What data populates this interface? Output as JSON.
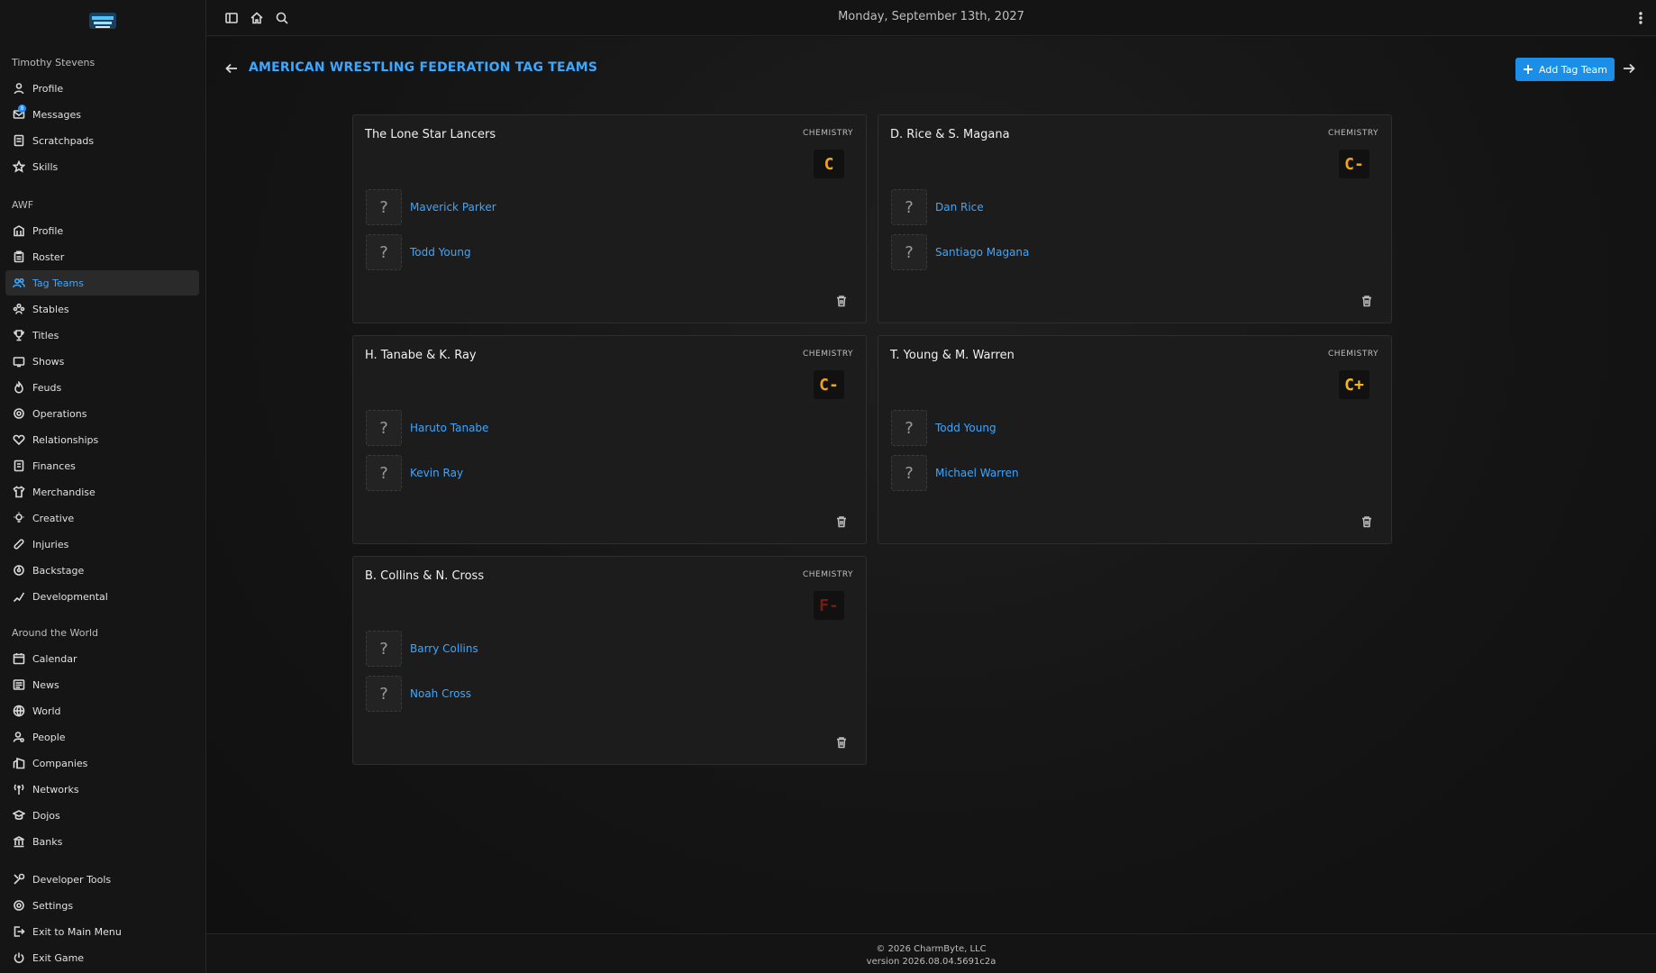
{
  "sidebar": {
    "user_name": "Timothy Stevens",
    "personal": [
      {
        "label": "Profile",
        "icon": "user-icon"
      },
      {
        "label": "Messages",
        "icon": "mail-icon",
        "badge": "8"
      },
      {
        "label": "Scratchpads",
        "icon": "notepad-icon"
      },
      {
        "label": "Skills",
        "icon": "star-icon"
      }
    ],
    "company_title": "AWF",
    "company": [
      {
        "label": "Profile",
        "icon": "building-icon"
      },
      {
        "label": "Roster",
        "icon": "clipboard-icon"
      },
      {
        "label": "Tag Teams",
        "icon": "users-icon"
      },
      {
        "label": "Stables",
        "icon": "group-icon"
      },
      {
        "label": "Titles",
        "icon": "trophy-icon"
      },
      {
        "label": "Shows",
        "icon": "tv-icon"
      },
      {
        "label": "Feuds",
        "icon": "flame-icon"
      },
      {
        "label": "Operations",
        "icon": "gear-icon"
      },
      {
        "label": "Relationships",
        "icon": "heart-icon"
      },
      {
        "label": "Finances",
        "icon": "finance-icon"
      },
      {
        "label": "Merchandise",
        "icon": "shirt-icon"
      },
      {
        "label": "Creative",
        "icon": "bulb-icon"
      },
      {
        "label": "Injuries",
        "icon": "bandage-icon"
      },
      {
        "label": "Backstage",
        "icon": "backstage-icon"
      },
      {
        "label": "Developmental",
        "icon": "growth-icon"
      }
    ],
    "world_title": "Around the World",
    "world": [
      {
        "label": "Calendar",
        "icon": "calendar-icon"
      },
      {
        "label": "News",
        "icon": "news-icon"
      },
      {
        "label": "World",
        "icon": "globe-icon"
      },
      {
        "label": "People",
        "icon": "person-search-icon"
      },
      {
        "label": "Companies",
        "icon": "companies-icon"
      },
      {
        "label": "Networks",
        "icon": "antenna-icon"
      },
      {
        "label": "Dojos",
        "icon": "graduation-icon"
      },
      {
        "label": "Banks",
        "icon": "bank-icon"
      }
    ],
    "system": [
      {
        "label": "Developer Tools",
        "icon": "tools-icon"
      },
      {
        "label": "Settings",
        "icon": "gear-icon"
      },
      {
        "label": "Exit to Main Menu",
        "icon": "exit-icon"
      },
      {
        "label": "Exit Game",
        "icon": "power-icon"
      }
    ]
  },
  "topbar": {
    "date": "Monday, September 13th, 2027"
  },
  "page": {
    "title": "AMERICAN WRESTLING FEDERATION TAG TEAMS",
    "add_button": "Add Tag Team",
    "chemistry_label": "CHEMISTRY"
  },
  "teams": [
    {
      "name": "The Lone Star Lancers",
      "grade": "C",
      "grade_color": "#f2a31b",
      "members": [
        "Maverick Parker",
        "Todd Young"
      ]
    },
    {
      "name": "D. Rice & S. Magana",
      "grade": "C-",
      "grade_color": "#f2a31b",
      "members": [
        "Dan Rice",
        "Santiago Magana"
      ]
    },
    {
      "name": "H. Tanabe & K. Ray",
      "grade": "C-",
      "grade_color": "#f2a31b",
      "members": [
        "Haruto Tanabe",
        "Kevin Ray"
      ]
    },
    {
      "name": "T. Young & M. Warren",
      "grade": "C+",
      "grade_color": "#f2b81b",
      "members": [
        "Todd Young",
        "Michael Warren"
      ]
    },
    {
      "name": "B. Collins & N. Cross",
      "grade": "F-",
      "grade_color": "#7a1a12",
      "members": [
        "Barry Collins",
        "Noah Cross"
      ]
    }
  ],
  "footer": {
    "copyright": "© 2026 CharmByte, LLC",
    "version": "version 2026.08.04.5691c2a"
  },
  "colors": {
    "accent": "#3ca7ff",
    "button": "#1b8fe8"
  }
}
